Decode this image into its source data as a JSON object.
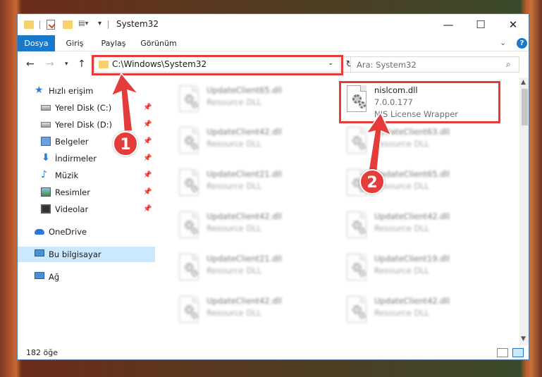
{
  "window": {
    "title": "System32",
    "minimize": "—",
    "maximize": "☐",
    "close": "✕"
  },
  "ribbon": {
    "tabs": [
      "Dosya",
      "Giriş",
      "Paylaş",
      "Görünüm"
    ],
    "help": "?"
  },
  "nav": {
    "address": "C:\\Windows\\System32",
    "search_placeholder": "Ara: System32"
  },
  "sidebar": {
    "items": [
      {
        "label": "Hızlı erişim",
        "icon": "star-icon"
      },
      {
        "label": "Yerel Disk (C:)",
        "icon": "disk-icon"
      },
      {
        "label": "Yerel Disk (D:)",
        "icon": "disk-icon"
      },
      {
        "label": "Belgeler",
        "icon": "documents-icon"
      },
      {
        "label": "İndirmeler",
        "icon": "download-icon"
      },
      {
        "label": "Müzik",
        "icon": "music-icon"
      },
      {
        "label": "Resimler",
        "icon": "pictures-icon"
      },
      {
        "label": "Videolar",
        "icon": "videos-icon"
      },
      {
        "label": "OneDrive",
        "icon": "cloud-icon"
      },
      {
        "label": "Bu bilgisayar",
        "icon": "computer-icon"
      },
      {
        "label": "Ağ",
        "icon": "network-icon"
      }
    ]
  },
  "files": {
    "highlighted": {
      "name": "nislcom.dll",
      "version": "7.0.0.177",
      "description": "NIS License Wrapper"
    },
    "blurred": [
      {
        "name": "UpdateClient65.dll",
        "type": "Resource DLL"
      },
      {
        "name": "UpdateClient42.dll",
        "type": "Resource DLL"
      },
      {
        "name": "UpdateClient63.dll",
        "type": "Resource DLL"
      },
      {
        "name": "UpdateClient21.dll",
        "type": "Resource DLL"
      },
      {
        "name": "UpdateClient65.dll",
        "type": "Resource DLL"
      },
      {
        "name": "UpdateClient42.dll",
        "type": "Resource DLL"
      },
      {
        "name": "UpdateClient42.dll",
        "type": "Resource DLL"
      },
      {
        "name": "UpdateClient21.dll",
        "type": "Resource DLL"
      },
      {
        "name": "UpdateClient19.dll",
        "type": "Resource DLL"
      },
      {
        "name": "UpdateClient42.dll",
        "type": "Resource DLL"
      },
      {
        "name": "UpdateClient42.dll",
        "type": "Resource DLL"
      }
    ]
  },
  "status": {
    "count": "182 öğe"
  },
  "callouts": [
    "1",
    "2"
  ],
  "colors": {
    "accent": "#1979ca",
    "highlight": "#e43b3b",
    "selection": "#cce8ff"
  }
}
